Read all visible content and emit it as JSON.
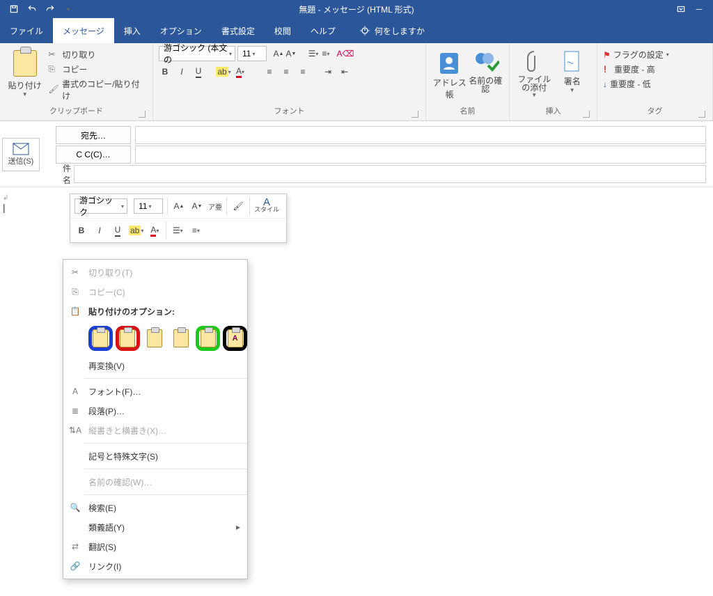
{
  "title": "無題  -  メッセージ (HTML 形式)",
  "tabs": [
    "ファイル",
    "メッセージ",
    "挿入",
    "オプション",
    "書式設定",
    "校閲",
    "ヘルプ"
  ],
  "activeTab": 1,
  "tell_me": "何をしますか",
  "groups": {
    "clipboard": {
      "paste": "貼り付け",
      "cut": "切り取り",
      "copy": "コピー",
      "format": "書式のコピー/貼り付け",
      "label": "クリップボード"
    },
    "font": {
      "name": "游ゴシック (本文の",
      "size": "11",
      "label": "フォント"
    },
    "names": {
      "address": "アドレス帳",
      "check": "名前の確認",
      "label": "名前"
    },
    "insert": {
      "attach": "ファイルの添付",
      "sign": "署名",
      "label": "挿入"
    },
    "tags": {
      "flag": "フラグの設定",
      "high": "重要度 - 高",
      "low": "重要度 - 低",
      "label": "タグ"
    }
  },
  "compose": {
    "send": "送信(S)",
    "to": "宛先…",
    "cc": "C C(C)…",
    "subject": "件名"
  },
  "mini": {
    "font": "游ゴシック",
    "size": "11",
    "style_label": "スタイル"
  },
  "context": {
    "cut": "切り取り(T)",
    "copy": "コピー(C)",
    "paste_heading": "貼り付けのオプション:",
    "reconvert": "再変換(V)",
    "font": "フォント(F)…",
    "paragraph": "段落(P)…",
    "direction": "縦書きと横書き(X)…",
    "symbols": "記号と特殊文字(S)",
    "checknames": "名前の確認(W)…",
    "search": "検索(E)",
    "synonyms": "類義語(Y)",
    "translate": "翻訳(S)",
    "link": "リンク(I)"
  },
  "markers": {
    "colors": [
      "#1a3fd6",
      "#d81313",
      "#1ec91e",
      "#000000"
    ]
  }
}
